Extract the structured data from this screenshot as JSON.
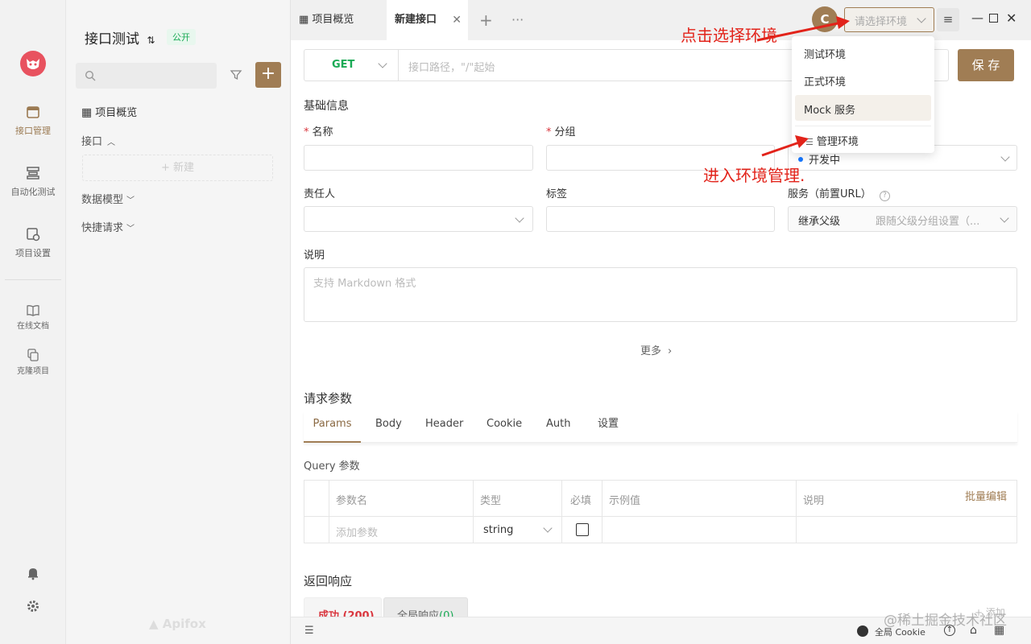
{
  "project": {
    "name": "接口测试",
    "visibility": "公开"
  },
  "rail": {
    "items": [
      {
        "label": "接口管理",
        "icon": "api-manage-icon"
      },
      {
        "label": "自动化测试",
        "icon": "automation-icon"
      },
      {
        "label": "项目设置",
        "icon": "project-settings-icon"
      },
      {
        "label": "在线文档",
        "icon": "book-icon"
      },
      {
        "label": "克隆项目",
        "icon": "clone-icon"
      }
    ]
  },
  "tree": {
    "overview": "项目概览",
    "api_group": "接口",
    "new_btn": "新建",
    "data_models": "数据模型",
    "quick_request": "快捷请求",
    "brand": "Apifox"
  },
  "tabs": [
    {
      "label": "项目概览"
    },
    {
      "label": "新建接口"
    }
  ],
  "env_select": {
    "placeholder": "请选择环境"
  },
  "env_menu": {
    "items": [
      "测试环境",
      "正式环境",
      "Mock 服务"
    ],
    "manage": "管理环境"
  },
  "annotations": {
    "select_env": "点击选择环境",
    "manage_env": "进入环境管理."
  },
  "request": {
    "method": "GET",
    "path_placeholder": "接口路径，\"/\"起始",
    "save": "保 存"
  },
  "basic": {
    "title": "基础信息",
    "name_label": "名称",
    "group_label": "分组",
    "status_value": "开发中",
    "owner_label": "责任人",
    "tag_label": "标签",
    "service_label": "服务（前置URL）",
    "service_value": "继承父级",
    "service_hint": "跟随父级分组设置（...",
    "desc_label": "说明",
    "desc_placeholder": "支持 Markdown 格式",
    "more": "更多"
  },
  "params": {
    "title": "请求参数",
    "tabs": [
      "Params",
      "Body",
      "Header",
      "Cookie",
      "Auth",
      "设置"
    ],
    "query_title": "Query 参数",
    "columns": [
      "参数名",
      "类型",
      "必填",
      "示例值",
      "说明"
    ],
    "bulk_edit": "批量编辑",
    "add_placeholder": "添加参数",
    "type_value": "string"
  },
  "response": {
    "title": "返回响应",
    "tab_success": "成功 (200)",
    "tab_global": "全局响应",
    "global_count": "(0)",
    "add": "添加"
  },
  "statusbar": {
    "cookie": "全局 Cookie"
  },
  "watermark": "@稀土掘金技术社区",
  "colors": {
    "accent": "#a07d54",
    "green": "#1aaa55",
    "red": "#e2231a"
  }
}
